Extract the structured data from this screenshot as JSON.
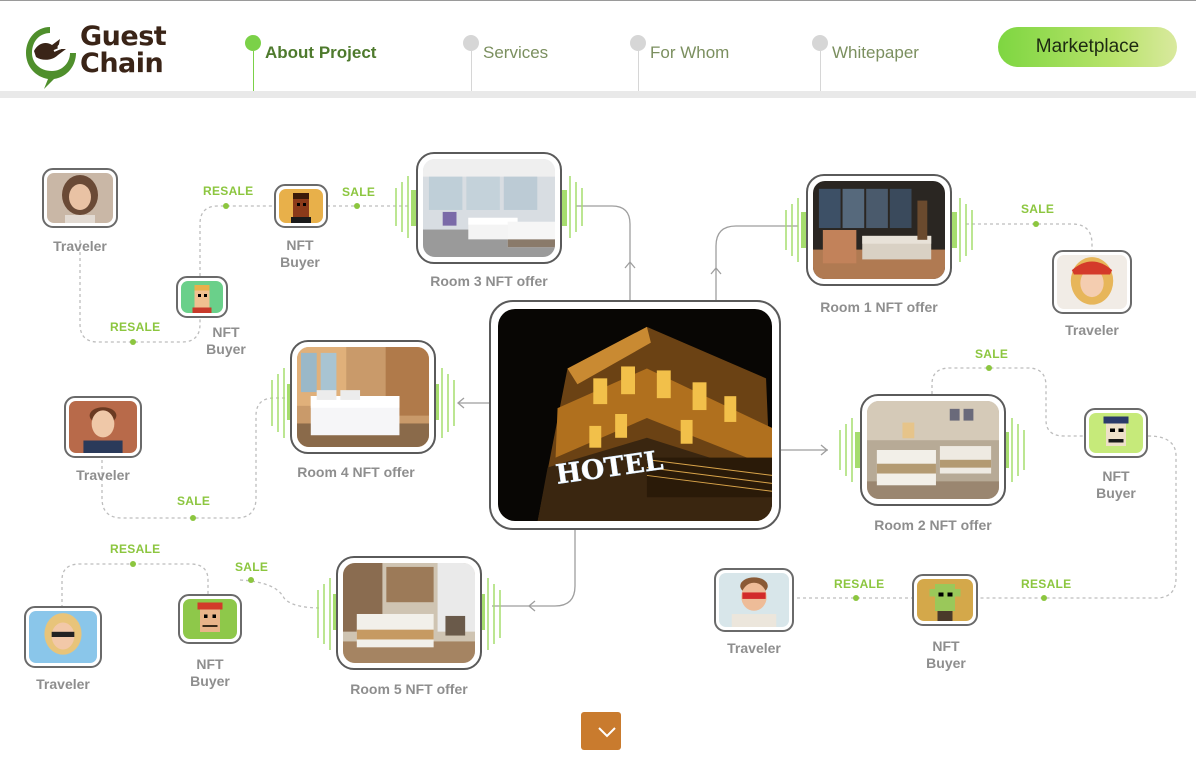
{
  "brand": {
    "line1": "Guest",
    "line2": "Chain"
  },
  "nav": [
    {
      "label": "About Project",
      "active": true
    },
    {
      "label": "Services",
      "active": false
    },
    {
      "label": "For Whom",
      "active": false
    },
    {
      "label": "Whitepaper",
      "active": false
    }
  ],
  "marketplace_label": "Marketplace",
  "diagram": {
    "rooms": {
      "room1": "Room 1 NFT offer",
      "room2": "Room 2 NFT offer",
      "room3": "Room 3 NFT offer",
      "room4": "Room 4 NFT offer",
      "room5": "Room 5 NFT offer"
    },
    "hotel_sign": "HOTEL",
    "traveler": "Traveler",
    "nft_buyer": {
      "line1": "NFT",
      "line2": "Buyer"
    },
    "sale": "SALE",
    "resale": "RESALE"
  },
  "colors": {
    "accent": "#7bd148",
    "tag": "#8cc63f",
    "brand_brown": "#3a2417",
    "scroll_button": "#c97b2e"
  },
  "icons": {
    "scroll": "chevron-down-icon",
    "logo": "guest-chain-bird-logo"
  }
}
